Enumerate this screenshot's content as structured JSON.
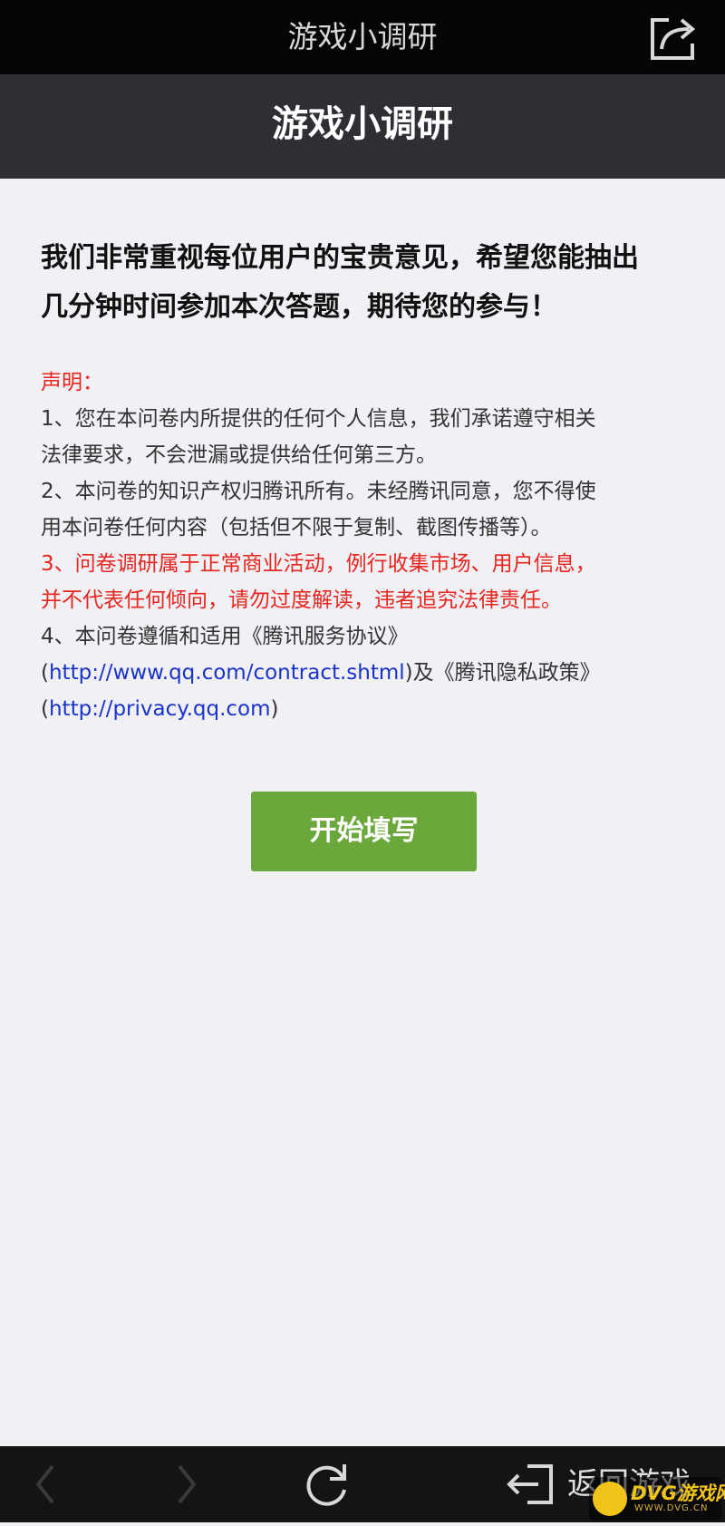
{
  "app_bar": {
    "title": "游戏小调研",
    "share_icon": "share-icon"
  },
  "header": {
    "title": "游戏小调研"
  },
  "content": {
    "intro_line1": "我们非常重视每位用户的宝贵意见，希望您能抽出",
    "intro_line2": "几分钟时间参加本次答题，期待您的参与！",
    "declaration_heading": "声明：",
    "item1_line1": "1、您在本问卷内所提供的任何个人信息，我们承诺遵守相关",
    "item1_line2": "法律要求，不会泄漏或提供给任何第三方。",
    "item2_line1": "2、本问卷的知识产权归腾讯所有。未经腾讯同意，您不得使",
    "item2_line2": "用本问卷任何内容（包括但不限于复制、截图传播等）。",
    "item3_line1": "3、问卷调研属于正常商业活动，例行收集市场、用户信息，",
    "item3_line2": "并不代表任何倾向，请勿过度解读，违者追究法律责任。",
    "item4_line1": "4、本问卷遵循和适用《腾讯服务协议》",
    "item4_paren_open1": "(",
    "item4_link1": "http://www.qq.com/contract.shtml",
    "item4_after_link1": ")及《腾讯隐私政策》",
    "item4_paren_open2": "(",
    "item4_link2": "http://privacy.qq.com",
    "item4_paren_close2": ")"
  },
  "start_button": {
    "label": "开始填写",
    "color": "#6ba83b"
  },
  "bottom_bar": {
    "back_icon": "chevron-left-icon",
    "forward_icon": "chevron-right-icon",
    "refresh_icon": "refresh-icon",
    "return_label": "返回游戏",
    "return_icon": "exit-icon"
  },
  "watermark": {
    "text": "DVG游戏网",
    "sub": "WWW.DVG.CN"
  },
  "colors": {
    "warning_red": "#e8251e",
    "link_blue": "#1a33c8",
    "header_bg": "#2e2f35",
    "page_bg": "#f0f0f5"
  }
}
